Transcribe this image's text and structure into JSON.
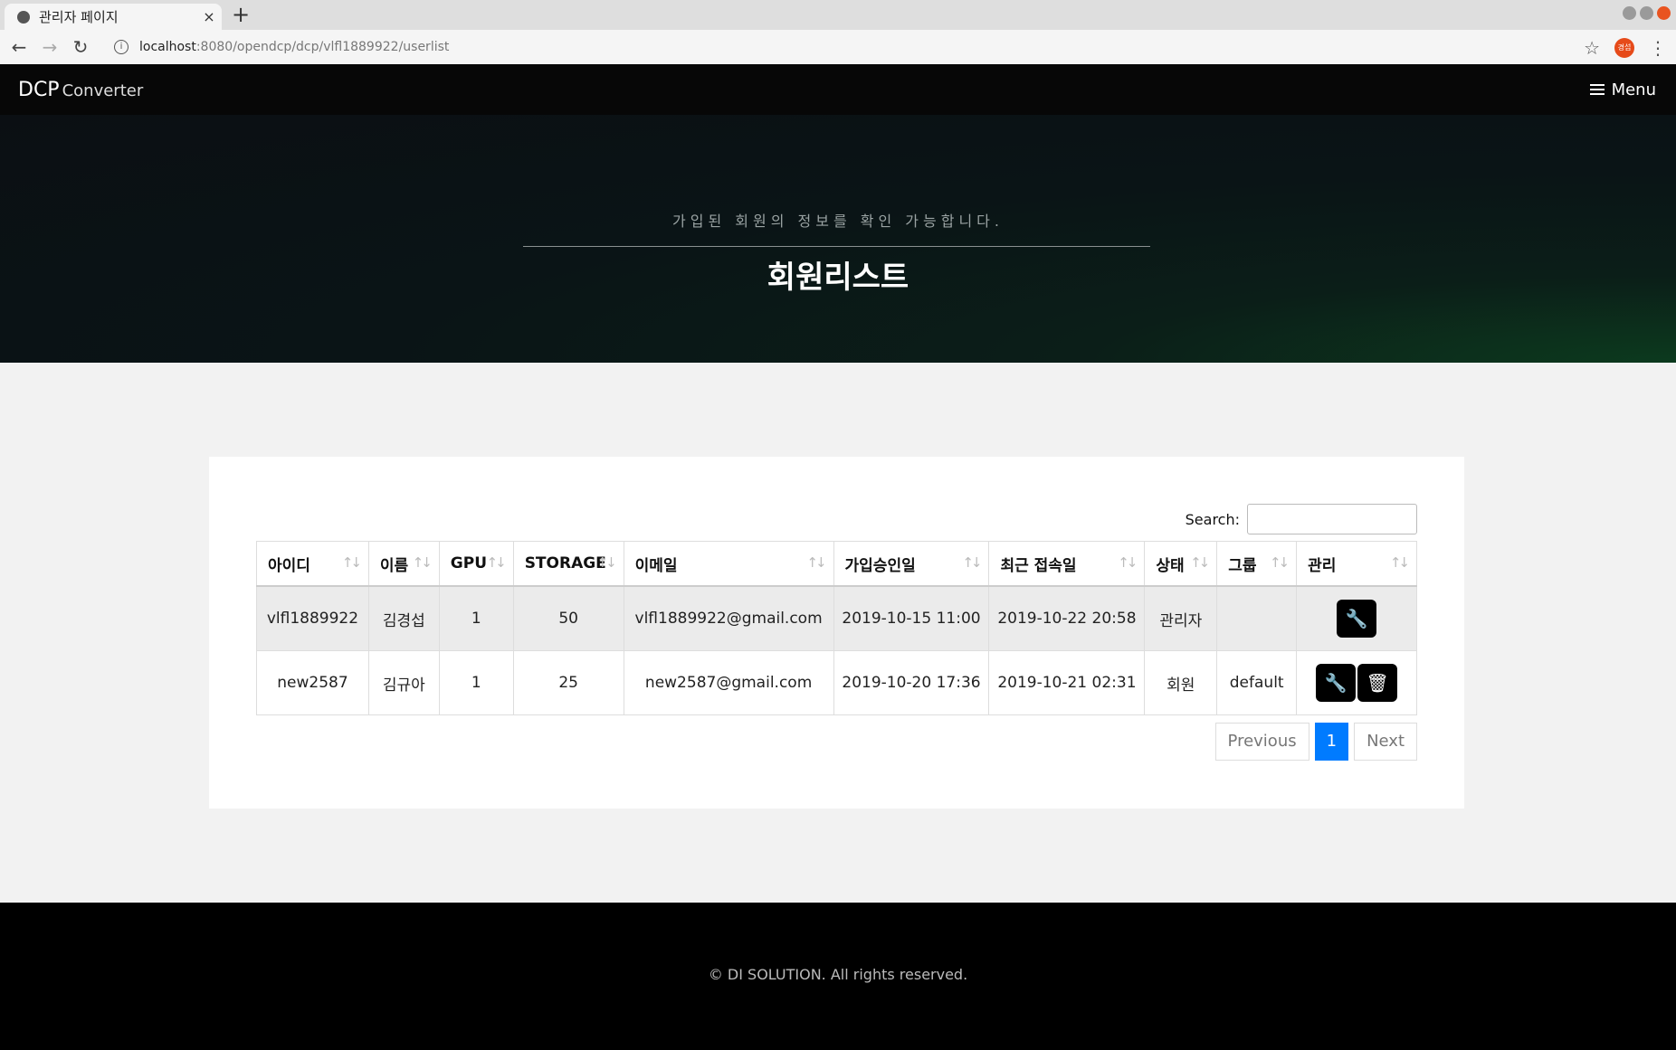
{
  "browser": {
    "tab_title": "관리자 페이지",
    "tab_close": "×",
    "new_tab": "+",
    "url_host": "localhost",
    "url_path": ":8080/opendcp/dcp/vlfl1889922/userlist",
    "profile_initials": "경섭",
    "back_icon": "←",
    "forward_icon": "→",
    "reload_icon": "↻",
    "star_icon": "☆",
    "kebab_icon": "⋮",
    "info_icon": "i"
  },
  "nav": {
    "brand": "DCP",
    "brand_sub": "Converter",
    "menu_label": "Menu"
  },
  "hero": {
    "subtitle": "가입된 회원의 정보를 확인 가능합니다.",
    "title": "회원리스트"
  },
  "search": {
    "label": "Search:",
    "value": ""
  },
  "table": {
    "sort_icon": "↑↓",
    "columns": [
      "아이디",
      "이름",
      "GPU",
      "STORAGE",
      "이메일",
      "가입승인일",
      "최근 접속일",
      "상태",
      "그룹",
      "관리"
    ],
    "rows": [
      {
        "id": "vlfl1889922",
        "name": "김경섭",
        "gpu": "1",
        "storage": "50",
        "email": "vlfl1889922@gmail.com",
        "approved": "2019-10-15 11:00",
        "last_login": "2019-10-22 20:58",
        "status": "관리자",
        "group": ""
      },
      {
        "id": "new2587",
        "name": "김규아",
        "gpu": "1",
        "storage": "25",
        "email": "new2587@gmail.com",
        "approved": "2019-10-20 17:36",
        "last_login": "2019-10-21 02:31",
        "status": "회원",
        "group": "default"
      }
    ],
    "edit_icon": "🔧",
    "delete_icon": "🗑"
  },
  "pagination": {
    "previous": "Previous",
    "current": "1",
    "next": "Next"
  },
  "footer": {
    "copyright": "© DI SOLUTION. All rights reserved."
  },
  "colors": {
    "accent": "#007bff",
    "nav_bg": "#070707",
    "footer_bg": "#000000"
  }
}
